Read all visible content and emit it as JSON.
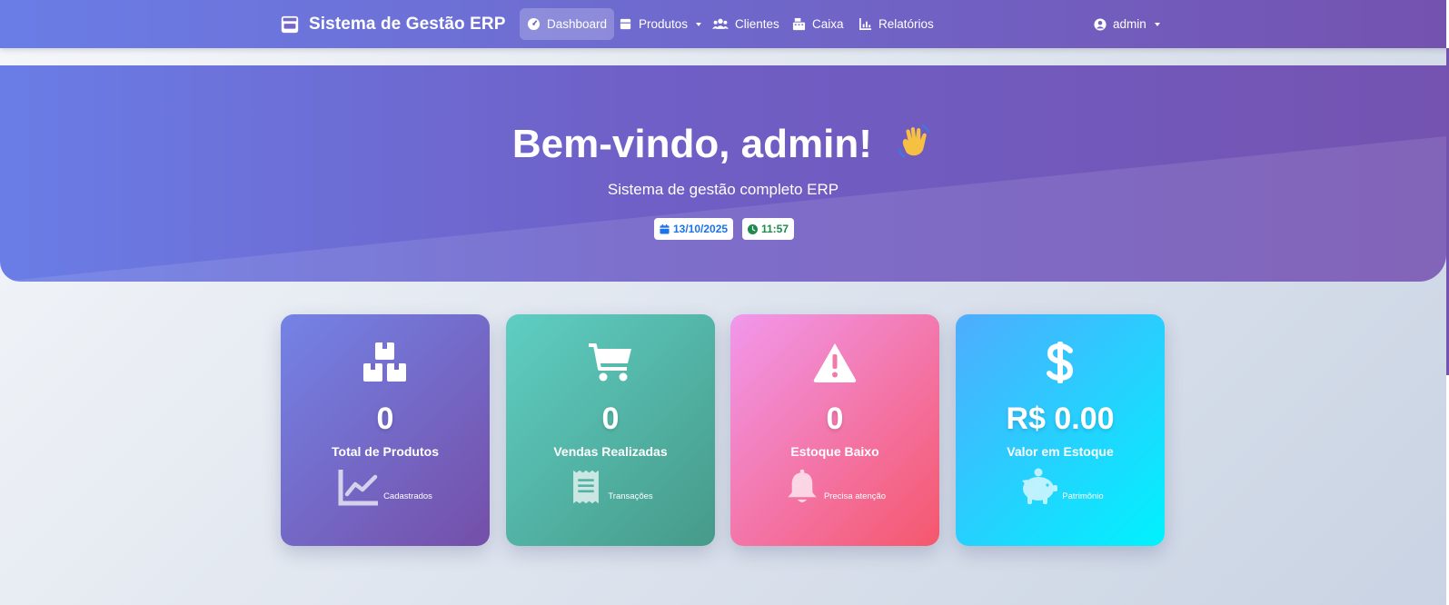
{
  "navbar": {
    "brand": "Sistema de Gestão ERP",
    "items": [
      {
        "label": "Dashboard"
      },
      {
        "label": "Produtos"
      },
      {
        "label": "Clientes"
      },
      {
        "label": "Caixa"
      },
      {
        "label": "Relatórios"
      }
    ],
    "user": "admin"
  },
  "hero": {
    "title": "Bem-vindo, admin!",
    "subtitle": "Sistema de gestão completo ERP",
    "date": "13/10/2025",
    "time": "11:57"
  },
  "cards": [
    {
      "icon": "boxes-icon",
      "value": "0",
      "label": "Total de Produtos",
      "foot_icon": "chart-line-icon",
      "foot": "Cadastrados"
    },
    {
      "icon": "shopping-cart-icon",
      "value": "0",
      "label": "Vendas Realizadas",
      "foot_icon": "receipt-icon",
      "foot": "Transações"
    },
    {
      "icon": "warning-icon",
      "value": "0",
      "label": "Estoque Baixo",
      "foot_icon": "bell-icon",
      "foot": "Precisa atenção"
    },
    {
      "icon": "dollar-icon",
      "value": "R$ 0.00",
      "label": "Valor em Estoque",
      "foot_icon": "piggy-bank-icon",
      "foot": "Patrimônio"
    }
  ],
  "colors": {
    "primary": "#6a7de6",
    "secondary": "#7452b0",
    "date_pill_text": "#1a73e8",
    "time_pill_text": "#1e8a4c"
  }
}
